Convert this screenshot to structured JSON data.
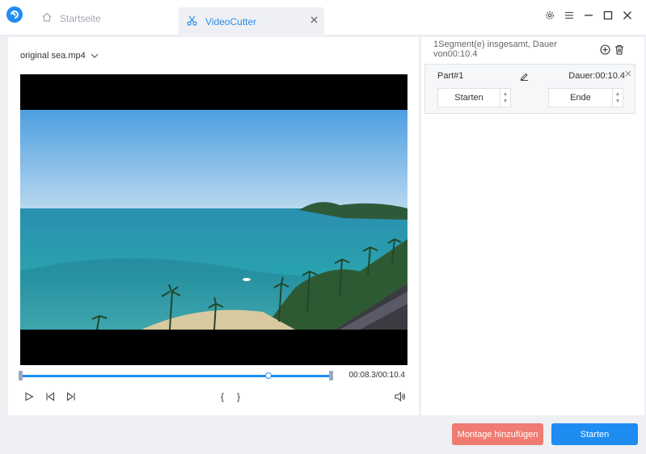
{
  "titlebar": {
    "tabs": [
      {
        "label": "Startseite",
        "icon": "home-icon"
      },
      {
        "label": "VideoCutter",
        "icon": "scissors-icon"
      }
    ],
    "controls": [
      "gear-icon",
      "menu-icon",
      "minimize-icon",
      "maximize-icon",
      "close-icon"
    ]
  },
  "player": {
    "file_name": "original sea.mp4",
    "time_readout": "00:08.3/00:10.4",
    "progress_fraction": 0.798,
    "marker_start": "{",
    "marker_end": "}"
  },
  "segments": {
    "summary": "1Segment(e) insgesamt, Dauer von00:10.4",
    "items": [
      {
        "name": "Part#1",
        "duration": "Dauer:00:10.4",
        "start_label": "Starten",
        "end_label": "Ende"
      }
    ]
  },
  "buttons": {
    "montage_label": "Montage hinzufügen",
    "start_label": "Starten"
  },
  "colors": {
    "accent": "#1e8cf0",
    "montage": "#ef7b72",
    "background": "#eef0f4"
  }
}
